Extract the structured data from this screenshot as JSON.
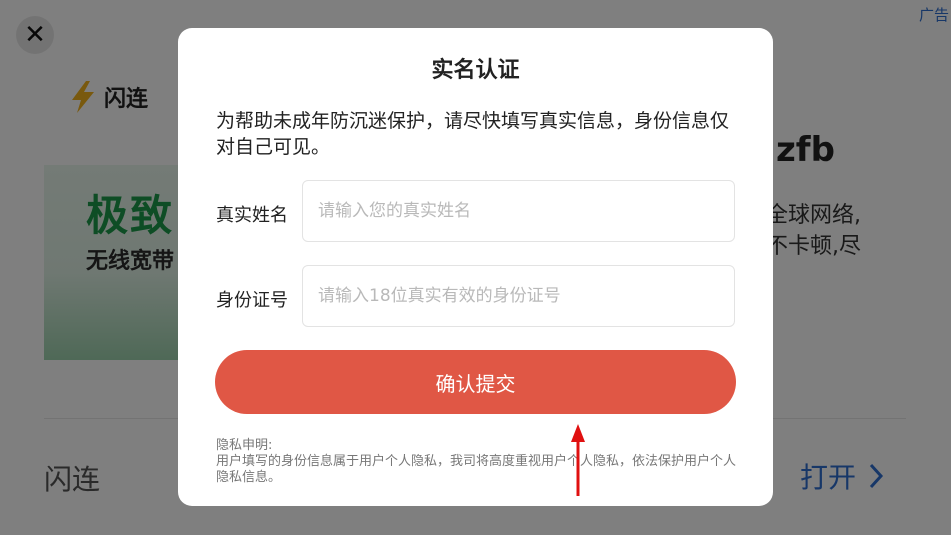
{
  "background": {
    "ad_tag": "广告",
    "close_glyph": "✕",
    "logo_text": "闪连",
    "banner_title": "极致",
    "banner_subtitle": "无线宽带",
    "right_title": "zfb",
    "right_desc_line1": "全球网络,",
    "right_desc_line2": "不卡顿,尽",
    "app_name": "闪连",
    "open_label": "打开"
  },
  "dialog": {
    "title": "实名认证",
    "description": "为帮助未成年防沉迷保护，请尽快填写真实信息，身份信息仅对自己可见。",
    "name_field": {
      "label": "真实姓名",
      "value": "",
      "placeholder": "请输入您的真实姓名"
    },
    "id_field": {
      "label": "身份证号",
      "value": "",
      "placeholder": "请输入18位真实有效的身份证号"
    },
    "submit_label": "确认提交",
    "privacy_title": "隐私申明:",
    "privacy_text": "用户填写的身份信息属于用户个人隐私，我司将高度重视用户个人隐私，依法保护用户个人隐私信息。"
  },
  "colors": {
    "accent": "#e05745",
    "link": "#2f6fd0",
    "banner_green": "#1d9a4a",
    "annotation": "#e01010"
  },
  "icons": [
    "close-icon",
    "lightning-bolt-icon",
    "chevron-right-icon",
    "red-arrow-icon"
  ]
}
